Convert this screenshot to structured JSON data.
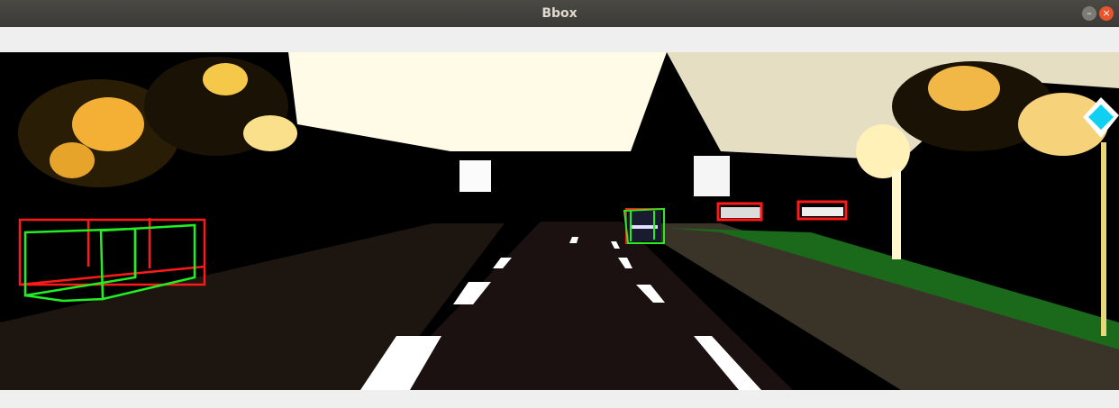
{
  "window": {
    "title": "Bbox",
    "minimize_glyph": "–",
    "close_glyph": "×"
  },
  "colors": {
    "box_2d": "#ff1a1a",
    "box_3d": "#22ee22",
    "road": "#1b1111",
    "sky": "#fffbe6"
  },
  "icons": {
    "minimize": "minimize-icon",
    "close": "close-icon"
  },
  "detections": [
    {
      "label": "car",
      "box_2d": true,
      "box_3d": true
    },
    {
      "label": "car",
      "box_2d": true,
      "box_3d": true
    },
    {
      "label": "car",
      "box_2d": true,
      "box_3d": false
    },
    {
      "label": "car",
      "box_2d": true,
      "box_3d": false
    }
  ]
}
